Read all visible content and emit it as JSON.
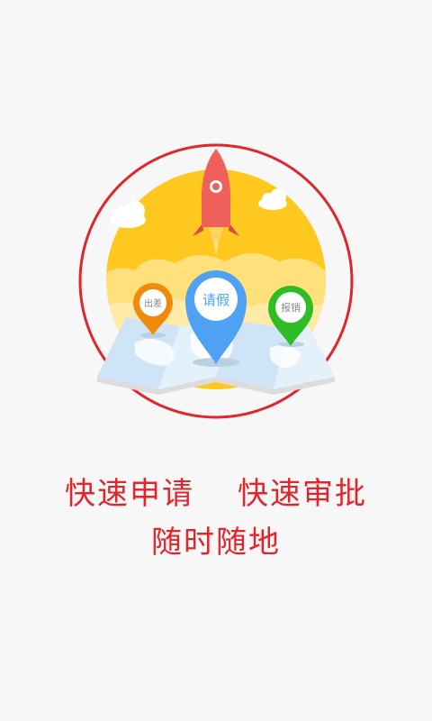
{
  "illustration": {
    "pins": {
      "left": {
        "label": "出差",
        "color": "#f08a0c"
      },
      "center": {
        "label": "请假",
        "color": "#4ea1f3"
      },
      "right": {
        "label": "报销",
        "color": "#2ebd25"
      }
    },
    "ring_color": "#e0262c",
    "sun_color": "#ffc81e",
    "rocket_color": "#f0605a"
  },
  "slogan": {
    "phrase_1": "快速申请",
    "phrase_2": "快速审批",
    "phrase_3": "随时随地"
  }
}
